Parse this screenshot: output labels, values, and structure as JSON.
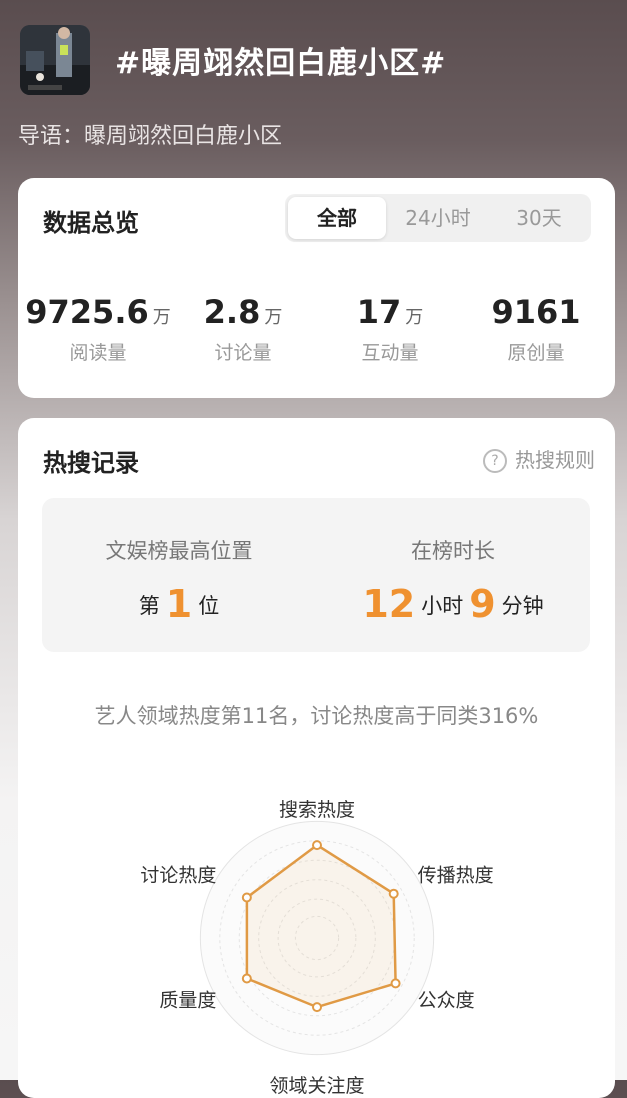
{
  "topic": {
    "title": "#曝周翊然回白鹿小区#",
    "intro": "导语：曝周翊然回白鹿小区"
  },
  "overview": {
    "title": "数据总览",
    "tabs": [
      {
        "label": "全部",
        "active": true
      },
      {
        "label": "24小时",
        "active": false
      },
      {
        "label": "30天",
        "active": false
      }
    ],
    "stats": [
      {
        "value": "9725.6",
        "unit": "万",
        "label": "阅读量"
      },
      {
        "value": "2.8",
        "unit": "万",
        "label": "讨论量"
      },
      {
        "value": "17",
        "unit": "万",
        "label": "互动量"
      },
      {
        "value": "9161",
        "unit": "",
        "label": "原创量"
      }
    ]
  },
  "hot_search": {
    "title": "热搜记录",
    "rules_label": "热搜规则",
    "rank_label": "文娱榜最高位置",
    "rank_prefix": "第",
    "rank_value": "1",
    "rank_suffix": "位",
    "duration_label": "在榜时长",
    "hours_value": "12",
    "hours_unit": "小时",
    "minutes_value": "9",
    "minutes_unit": "分钟",
    "summary": "艺人领域热度第11名，讨论热度高于同类316%"
  },
  "radar": {
    "accent": "#e09a45",
    "axes": [
      {
        "label": "搜索热度",
        "value": 0.86
      },
      {
        "label": "传播热度",
        "value": 0.82
      },
      {
        "label": "公众度",
        "value": 0.84
      },
      {
        "label": "领域关注度",
        "value": 0.64
      },
      {
        "label": "质量度",
        "value": 0.75
      },
      {
        "label": "讨论热度",
        "value": 0.75
      }
    ]
  }
}
